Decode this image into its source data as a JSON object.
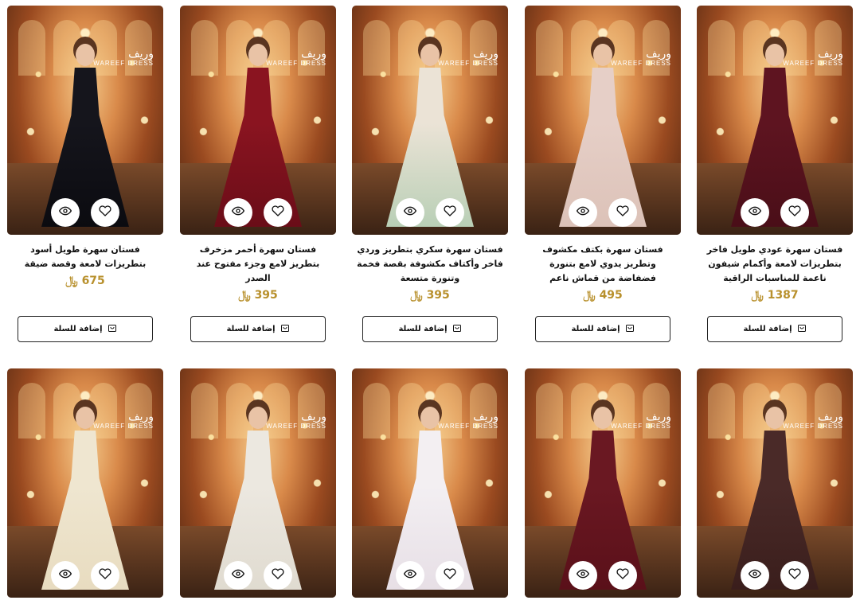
{
  "brand": {
    "latin": "WAREEF",
    "sub": "DRESS",
    "script": "وريف"
  },
  "currency_symbol": "﷼",
  "add_to_cart_label": "إضافة للسلة",
  "products": [
    {
      "title": "فستان سهرة طويل أسود بتطريزات لامعة وقصة ضيقة",
      "price": "675",
      "dress_color": "#15151c",
      "skirt_color": "#0b0b10"
    },
    {
      "title": "فستان سهرة أحمر مزخرف بتطريز لامع وجزء مفتوح عند الصدر",
      "price": "395",
      "dress_color": "#8a1420",
      "skirt_color": "#6a0d18"
    },
    {
      "title": "فستان سهرة سكري بتطريز وردي فاخر وأكتاف مكشوفة بقصة فخمة وتنورة متسعة",
      "price": "395",
      "dress_color": "#ebe3d6",
      "skirt_color": "#b9cfb6"
    },
    {
      "title": "فستان سهرة بكتف مكشوف وتطريز يدوي لامع بتنورة فضفاضة من قماش ناعم",
      "price": "495",
      "dress_color": "#e6cfc7",
      "skirt_color": "#dcc2b8"
    },
    {
      "title": "فستان سهرة عودي طويل فاخر بتطريزات لامعة وأكمام شيفون ناعمة للمناسبات الراقية",
      "price": "1387",
      "dress_color": "#5e1420",
      "skirt_color": "#4a0e18"
    },
    {
      "title": "",
      "price": "",
      "dress_color": "#efe6d0",
      "skirt_color": "#e8dcc0"
    },
    {
      "title": "",
      "price": "",
      "dress_color": "#ece8e0",
      "skirt_color": "#e0dbd0"
    },
    {
      "title": "",
      "price": "",
      "dress_color": "#f3eff2",
      "skirt_color": "#e7dfe6"
    },
    {
      "title": "",
      "price": "",
      "dress_color": "#6a1822",
      "skirt_color": "#5a1019"
    },
    {
      "title": "",
      "price": "",
      "dress_color": "#4a2a28",
      "skirt_color": "#3a1e1c"
    }
  ]
}
